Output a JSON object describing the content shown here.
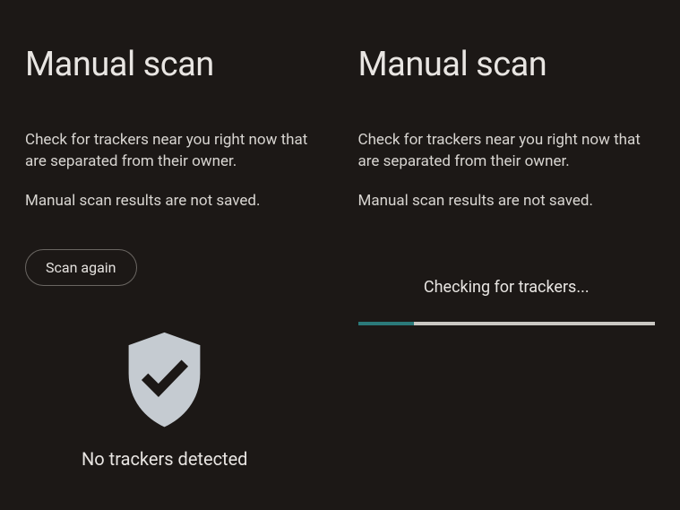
{
  "left": {
    "title": "Manual scan",
    "description1": "Check for trackers near you right now that are separated from their owner.",
    "description2": "Manual scan results are not saved.",
    "button_label": "Scan again",
    "result_text": "No trackers detected"
  },
  "right": {
    "title": "Manual scan",
    "description1": "Check for trackers near you right now that are separated from their owner.",
    "description2": "Manual scan results are not saved.",
    "checking_text": "Checking for trackers...",
    "progress_percent": 19
  },
  "colors": {
    "background": "#1c1816",
    "text": "#e4e1de",
    "accent": "#2b7a7a",
    "shield": "#c5cbd1"
  }
}
